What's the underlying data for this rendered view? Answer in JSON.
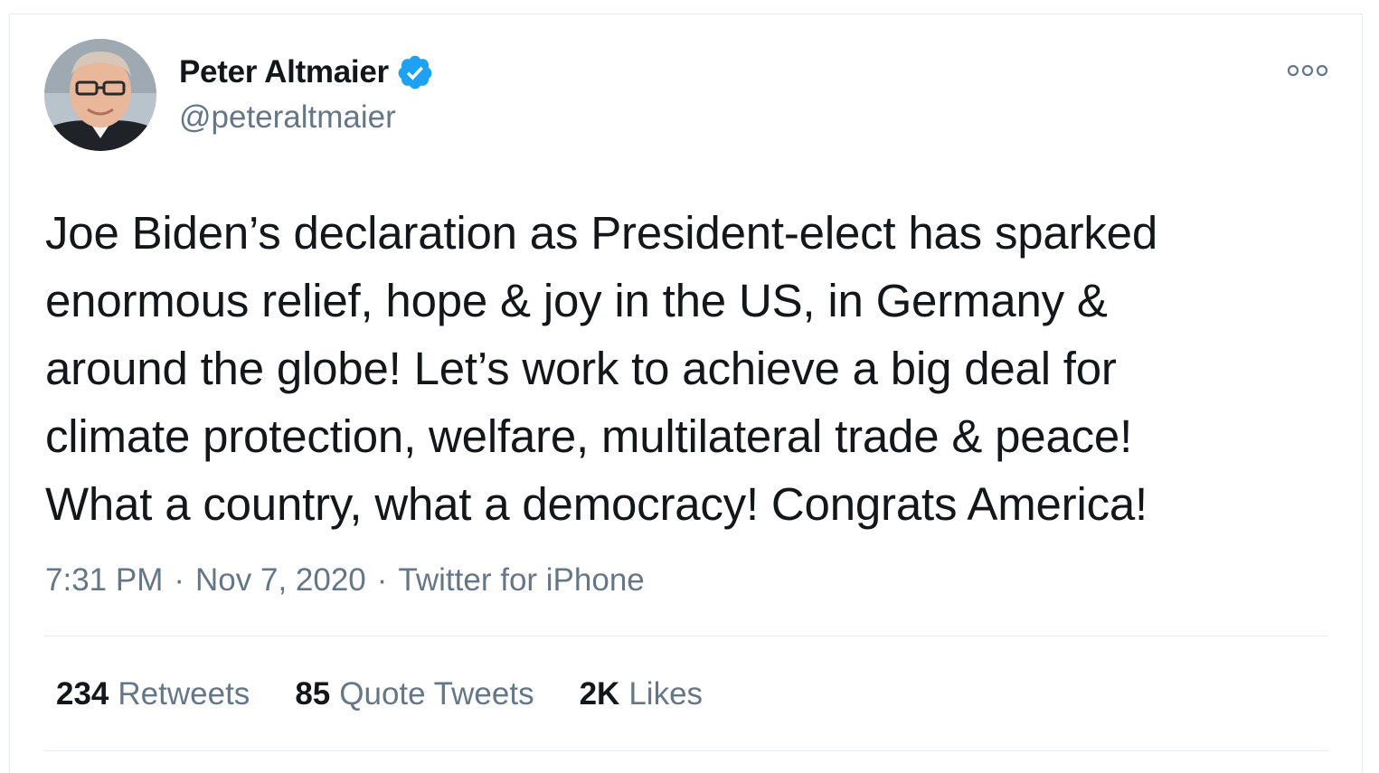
{
  "tweet": {
    "author": {
      "display_name": "Peter Altmaier",
      "handle": "@peteraltmaier",
      "verified": true,
      "verified_color": "#1da1f2"
    },
    "text": "Joe Biden’s declaration as President-elect has sparked\nenormous relief, hope & joy in the US, in Germany &\naround the globe! Let’s work to achieve a big deal for\nclimate protection, welfare, multilateral trade & peace!\nWhat a country, what a democracy! Congrats America!",
    "time": "7:31 PM",
    "date": "Nov 7, 2020",
    "source": "Twitter for iPhone",
    "separator": "·",
    "stats": {
      "retweets": {
        "count": "234",
        "label": "Retweets"
      },
      "quote_tweets": {
        "count": "85",
        "label": "Quote Tweets"
      },
      "likes": {
        "count": "2K",
        "label": "Likes"
      }
    }
  },
  "icons": {
    "more": "more-options-icon",
    "verified": "verified-badge-icon"
  }
}
